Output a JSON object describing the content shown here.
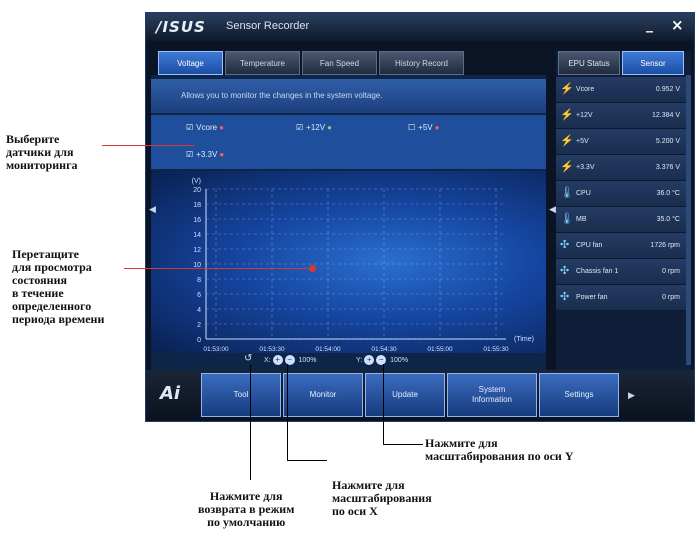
{
  "window": {
    "logo": "/ISUS",
    "title": "Sensor Recorder",
    "minimize_label": "_",
    "close_label": "×"
  },
  "tabs": [
    {
      "label": "Voltage",
      "active": true
    },
    {
      "label": "Temperature",
      "active": false
    },
    {
      "label": "Fan Speed",
      "active": false
    },
    {
      "label": "History Record",
      "active": false
    }
  ],
  "info_text": "Allows you to monitor the changes in the system voltage.",
  "sensors": [
    {
      "label": "Vcore",
      "checked": true,
      "color": "#ff5b5b"
    },
    {
      "label": "+12V",
      "checked": true,
      "color": "#73d66b"
    },
    {
      "label": "+5V",
      "checked": false,
      "color": "#ff5b5b"
    },
    {
      "label": "+3.3V",
      "checked": true,
      "color": "#ff5b5b"
    }
  ],
  "chart_data": {
    "type": "line",
    "ylabel": "(V)",
    "xlabel": "(Time)",
    "yticks": [
      20,
      18,
      16,
      14,
      12,
      10,
      8,
      6,
      4,
      2,
      0
    ],
    "ylim": [
      0,
      20
    ],
    "xticks": [
      "01:53:00",
      "01:53:30",
      "01:54:00",
      "01:54:30",
      "01:55:00",
      "01:55:30"
    ],
    "grid": true,
    "series": []
  },
  "controls": {
    "reset_icon": "↺",
    "x_axis_prefix": "X:",
    "x_zoom": "100%",
    "y_axis_prefix": "Y:",
    "y_zoom": "100%"
  },
  "right_tabs": [
    {
      "label": "EPU Status",
      "active": false
    },
    {
      "label": "Sensor",
      "active": true
    }
  ],
  "sensor_readings": [
    {
      "icon": "bolt-icon",
      "glyph": "⚡",
      "name": "Vcore",
      "value": "0.952 V"
    },
    {
      "icon": "bolt-icon",
      "glyph": "⚡",
      "name": "+12V",
      "value": "12.384 V"
    },
    {
      "icon": "bolt-icon",
      "glyph": "⚡",
      "name": "+5V",
      "value": "5.200 V"
    },
    {
      "icon": "bolt-icon",
      "glyph": "⚡",
      "name": "+3.3V",
      "value": "3.376 V"
    },
    {
      "icon": "thermometer-icon",
      "glyph": "🌡",
      "name": "CPU",
      "value": "36.0 °C"
    },
    {
      "icon": "thermometer-icon",
      "glyph": "🌡",
      "name": "MB",
      "value": "35.0 °C"
    },
    {
      "icon": "fan-icon",
      "glyph": "✣",
      "name": "CPU fan",
      "value": "1726 rpm"
    },
    {
      "icon": "fan-icon",
      "glyph": "✣",
      "name": "Chassis fan 1",
      "value": "0 rpm"
    },
    {
      "icon": "fan-icon",
      "glyph": "✣",
      "name": "Power fan",
      "value": "0 rpm"
    }
  ],
  "nav": [
    {
      "label": "Tool"
    },
    {
      "label": "Monitor"
    },
    {
      "label": "Update"
    },
    {
      "label": "System\nInformation"
    },
    {
      "label": "Settings"
    }
  ],
  "annotations": {
    "select_sensors": "Выберите\nдатчики для\nмониторинга",
    "drag_view": "Перетащите\nдля просмотра\nсостояния\nв течение\nопределенного\nпериода времени",
    "zoom_y": "Нажмите для\nмасштабирования по оси Y",
    "zoom_x": "Нажмите для\nмасштабирования\nпо оси X",
    "reset_default": "Нажмите для\nвозврата в режим\nпо умолчанию"
  }
}
